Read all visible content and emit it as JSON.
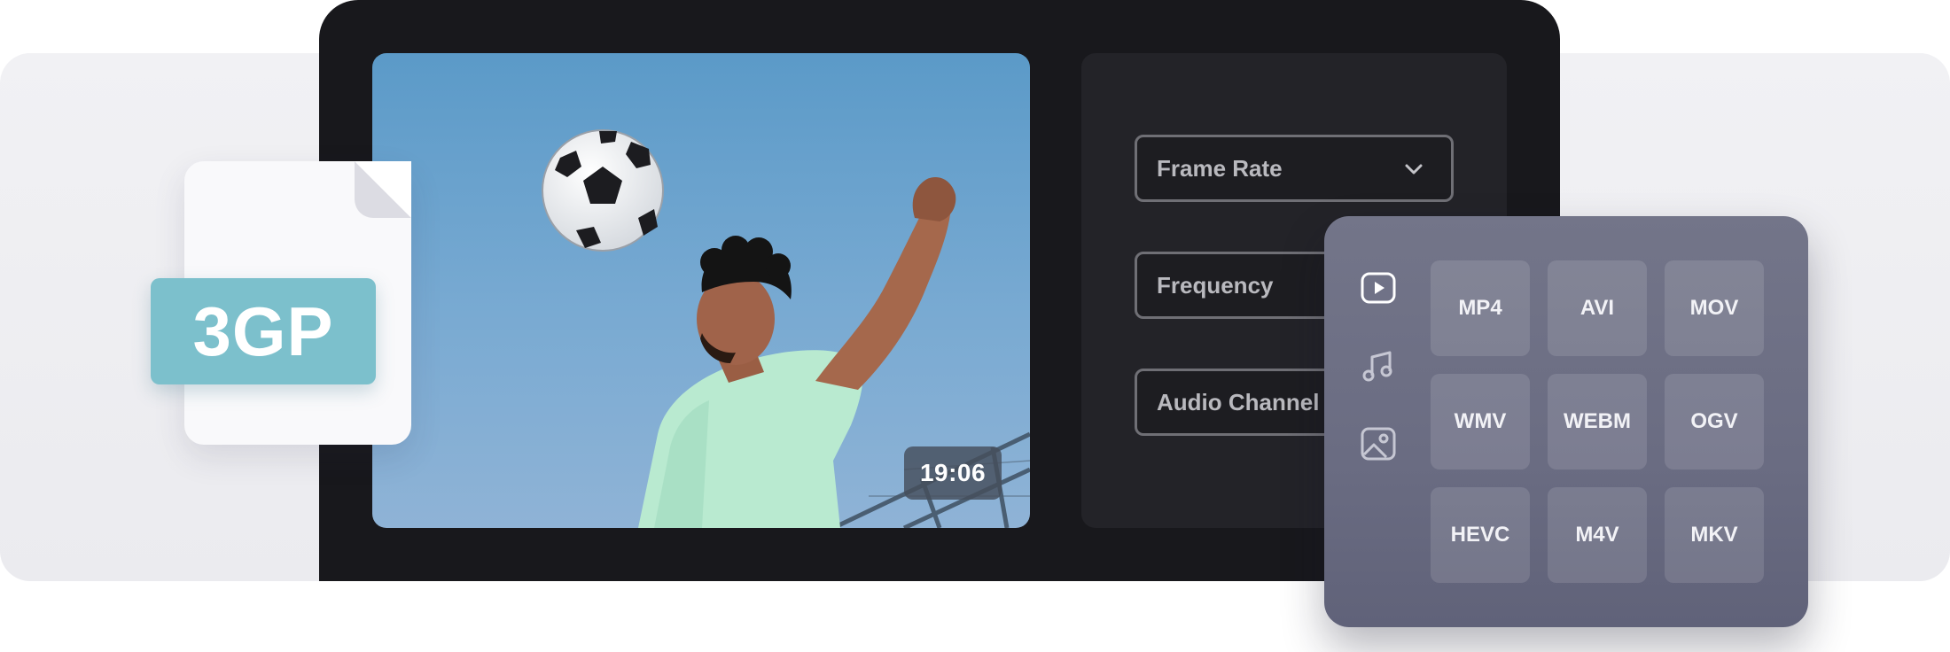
{
  "preview": {
    "duration": "19:06"
  },
  "file_badge": {
    "format_label": "3GP"
  },
  "settings": {
    "frame_rate_label": "Frame Rate",
    "frequency_label": "Frequency",
    "audio_channel_label": "Audio Channel"
  },
  "format_picker": {
    "tabs": [
      {
        "icon": "video-play-icon",
        "active": true
      },
      {
        "icon": "music-note-icon",
        "active": false
      },
      {
        "icon": "image-icon",
        "active": false
      }
    ],
    "formats": [
      "MP4",
      "AVI",
      "MOV",
      "WMV",
      "WEBM",
      "OGV",
      "HEVC",
      "M4V",
      "MKV"
    ]
  },
  "colors": {
    "device": "#18181c",
    "badge_teal": "#7cc0cc",
    "panel": "#6d6f85"
  }
}
